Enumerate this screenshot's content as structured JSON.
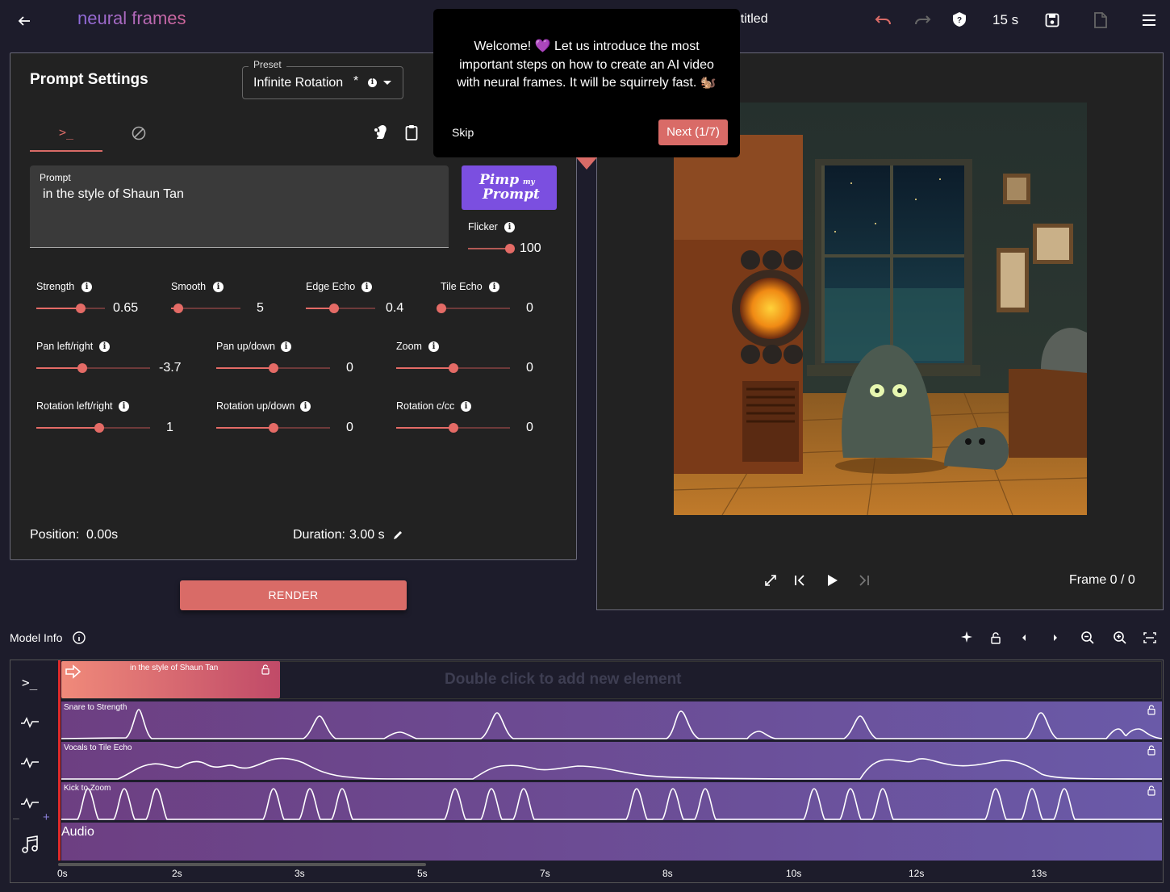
{
  "app": {
    "brand": "neural frames",
    "title": "untitled",
    "duration": "15 s"
  },
  "prompt_settings": {
    "title": "Prompt Settings",
    "preset_label": "Preset",
    "preset_value": "Infinite Rotation",
    "preset_modified_mark": "*",
    "prompt_label": "Prompt",
    "prompt_text": "in the style of Shaun Tan",
    "pimp_button_line1": "Pimp",
    "pimp_button_my": "my",
    "pimp_button_line2": "Prompt",
    "flicker": {
      "label": "Flicker",
      "value": "100",
      "level": 1.0
    },
    "sliders_row1": [
      {
        "label": "Strength",
        "value": "0.65",
        "level": 0.65
      },
      {
        "label": "Smooth",
        "value": "5",
        "level": 0.1
      },
      {
        "label": "Edge Echo",
        "value": "0.4",
        "level": 0.4
      },
      {
        "label": "Tile Echo",
        "value": "0",
        "level": 0.0
      }
    ],
    "sliders_row2": [
      {
        "label": "Pan left/right",
        "value": "-3.7",
        "level": 0.4
      },
      {
        "label": "Pan up/down",
        "value": "0",
        "level": 0.5
      },
      {
        "label": "Zoom",
        "value": "0",
        "level": 0.5
      }
    ],
    "sliders_row3": [
      {
        "label": "Rotation left/right",
        "value": "1",
        "level": 0.55
      },
      {
        "label": "Rotation up/down",
        "value": "0",
        "level": 0.5
      },
      {
        "label": "Rotation c/cc",
        "value": "0",
        "level": 0.5
      }
    ],
    "position_label": "Position:",
    "position_value": "0.00s",
    "duration_label": "Duration:",
    "duration_value": "3.00 s"
  },
  "render_button": "RENDER",
  "tooltip": {
    "text": "Welcome! 💜 Let us introduce the most important steps on how to create an AI video with neural frames. It will be squirrely fast. 🐿️",
    "skip": "Skip",
    "next": "Next (1/7)"
  },
  "preview": {
    "frame_label": "Frame 0 / 0"
  },
  "timeline": {
    "model_info": "Model Info",
    "prompt_clip_text": "in the style of Shaun Tan",
    "empty_hint": "Double click to add new element",
    "lanes": [
      {
        "label": "Snare to Strength"
      },
      {
        "label": "Vocals to Tile Echo"
      },
      {
        "label": "Kick to Zoom"
      }
    ],
    "audio_label": "Audio",
    "ticks": [
      "0s",
      "2s",
      "3s",
      "5s",
      "7s",
      "8s",
      "10s",
      "12s",
      "13s"
    ]
  },
  "colors": {
    "accent": "#d96b67",
    "pimp": "#7b4fe0",
    "lane_start": "#6d3f82",
    "lane_end": "#6a5aa8"
  }
}
